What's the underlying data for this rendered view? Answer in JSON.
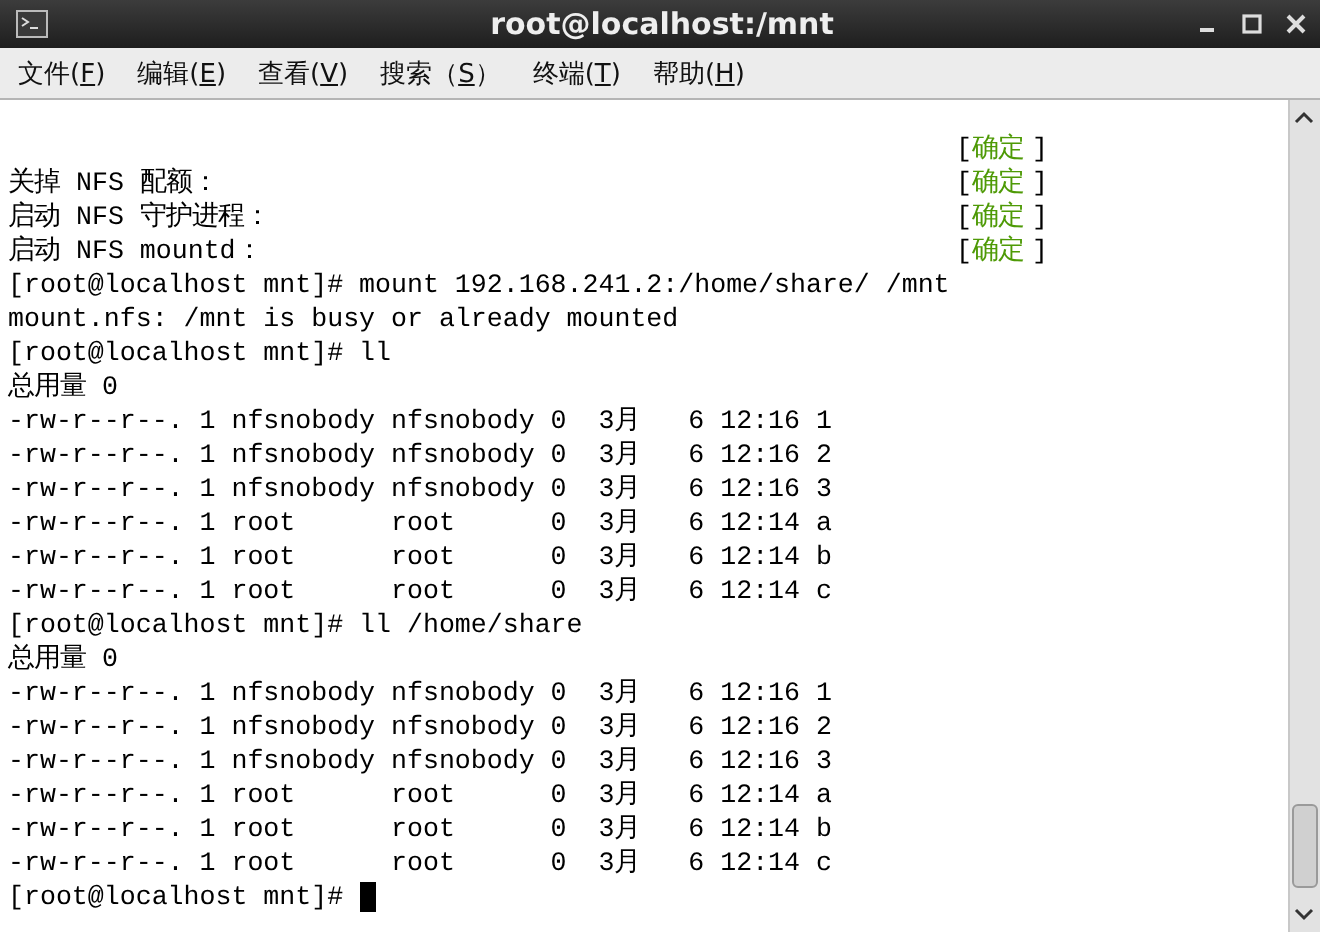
{
  "window": {
    "title": "root@localhost:/mnt"
  },
  "menu": [
    {
      "before": "文件(",
      "key": "F",
      "after": ")"
    },
    {
      "before": "编辑(",
      "key": "E",
      "after": ")"
    },
    {
      "before": "查看(",
      "key": "V",
      "after": ")"
    },
    {
      "before": "搜索（",
      "key": "S",
      "after": "）"
    },
    {
      "before": "终端(",
      "key": "T",
      "after": ")"
    },
    {
      "before": "帮助(",
      "key": "H",
      "after": ")"
    }
  ],
  "terminal": {
    "lines": [
      {
        "status": {
          "open": "[",
          "label": "确定",
          "close": "]"
        }
      },
      {
        "text": "关掉 NFS 配额：",
        "status": {
          "open": "[",
          "label": "确定",
          "close": "]"
        }
      },
      {
        "text": "启动 NFS 守护进程：",
        "status": {
          "open": "[",
          "label": "确定",
          "close": "]"
        }
      },
      {
        "text": "启动 NFS mountd：",
        "status": {
          "open": "[",
          "label": "确定",
          "close": "]"
        }
      },
      {
        "text": "[root@localhost mnt]# mount 192.168.241.2:/home/share/ /mnt"
      },
      {
        "text": "mount.nfs: /mnt is busy or already mounted"
      },
      {
        "text": "[root@localhost mnt]# ll"
      },
      {
        "text": "总用量 0"
      },
      {
        "text": "-rw-r--r--. 1 nfsnobody nfsnobody 0  3月   6 12:16 1"
      },
      {
        "text": "-rw-r--r--. 1 nfsnobody nfsnobody 0  3月   6 12:16 2"
      },
      {
        "text": "-rw-r--r--. 1 nfsnobody nfsnobody 0  3月   6 12:16 3"
      },
      {
        "text": "-rw-r--r--. 1 root      root      0  3月   6 12:14 a"
      },
      {
        "text": "-rw-r--r--. 1 root      root      0  3月   6 12:14 b"
      },
      {
        "text": "-rw-r--r--. 1 root      root      0  3月   6 12:14 c"
      },
      {
        "text": "[root@localhost mnt]# ll /home/share"
      },
      {
        "text": "总用量 0"
      },
      {
        "text": "-rw-r--r--. 1 nfsnobody nfsnobody 0  3月   6 12:16 1"
      },
      {
        "text": "-rw-r--r--. 1 nfsnobody nfsnobody 0  3月   6 12:16 2"
      },
      {
        "text": "-rw-r--r--. 1 nfsnobody nfsnobody 0  3月   6 12:16 3"
      },
      {
        "text": "-rw-r--r--. 1 root      root      0  3月   6 12:14 a"
      },
      {
        "text": "-rw-r--r--. 1 root      root      0  3月   6 12:14 b"
      },
      {
        "text": "-rw-r--r--. 1 root      root      0  3月   6 12:14 c"
      },
      {
        "text": "[root@localhost mnt]# ",
        "cursor": true
      }
    ]
  }
}
